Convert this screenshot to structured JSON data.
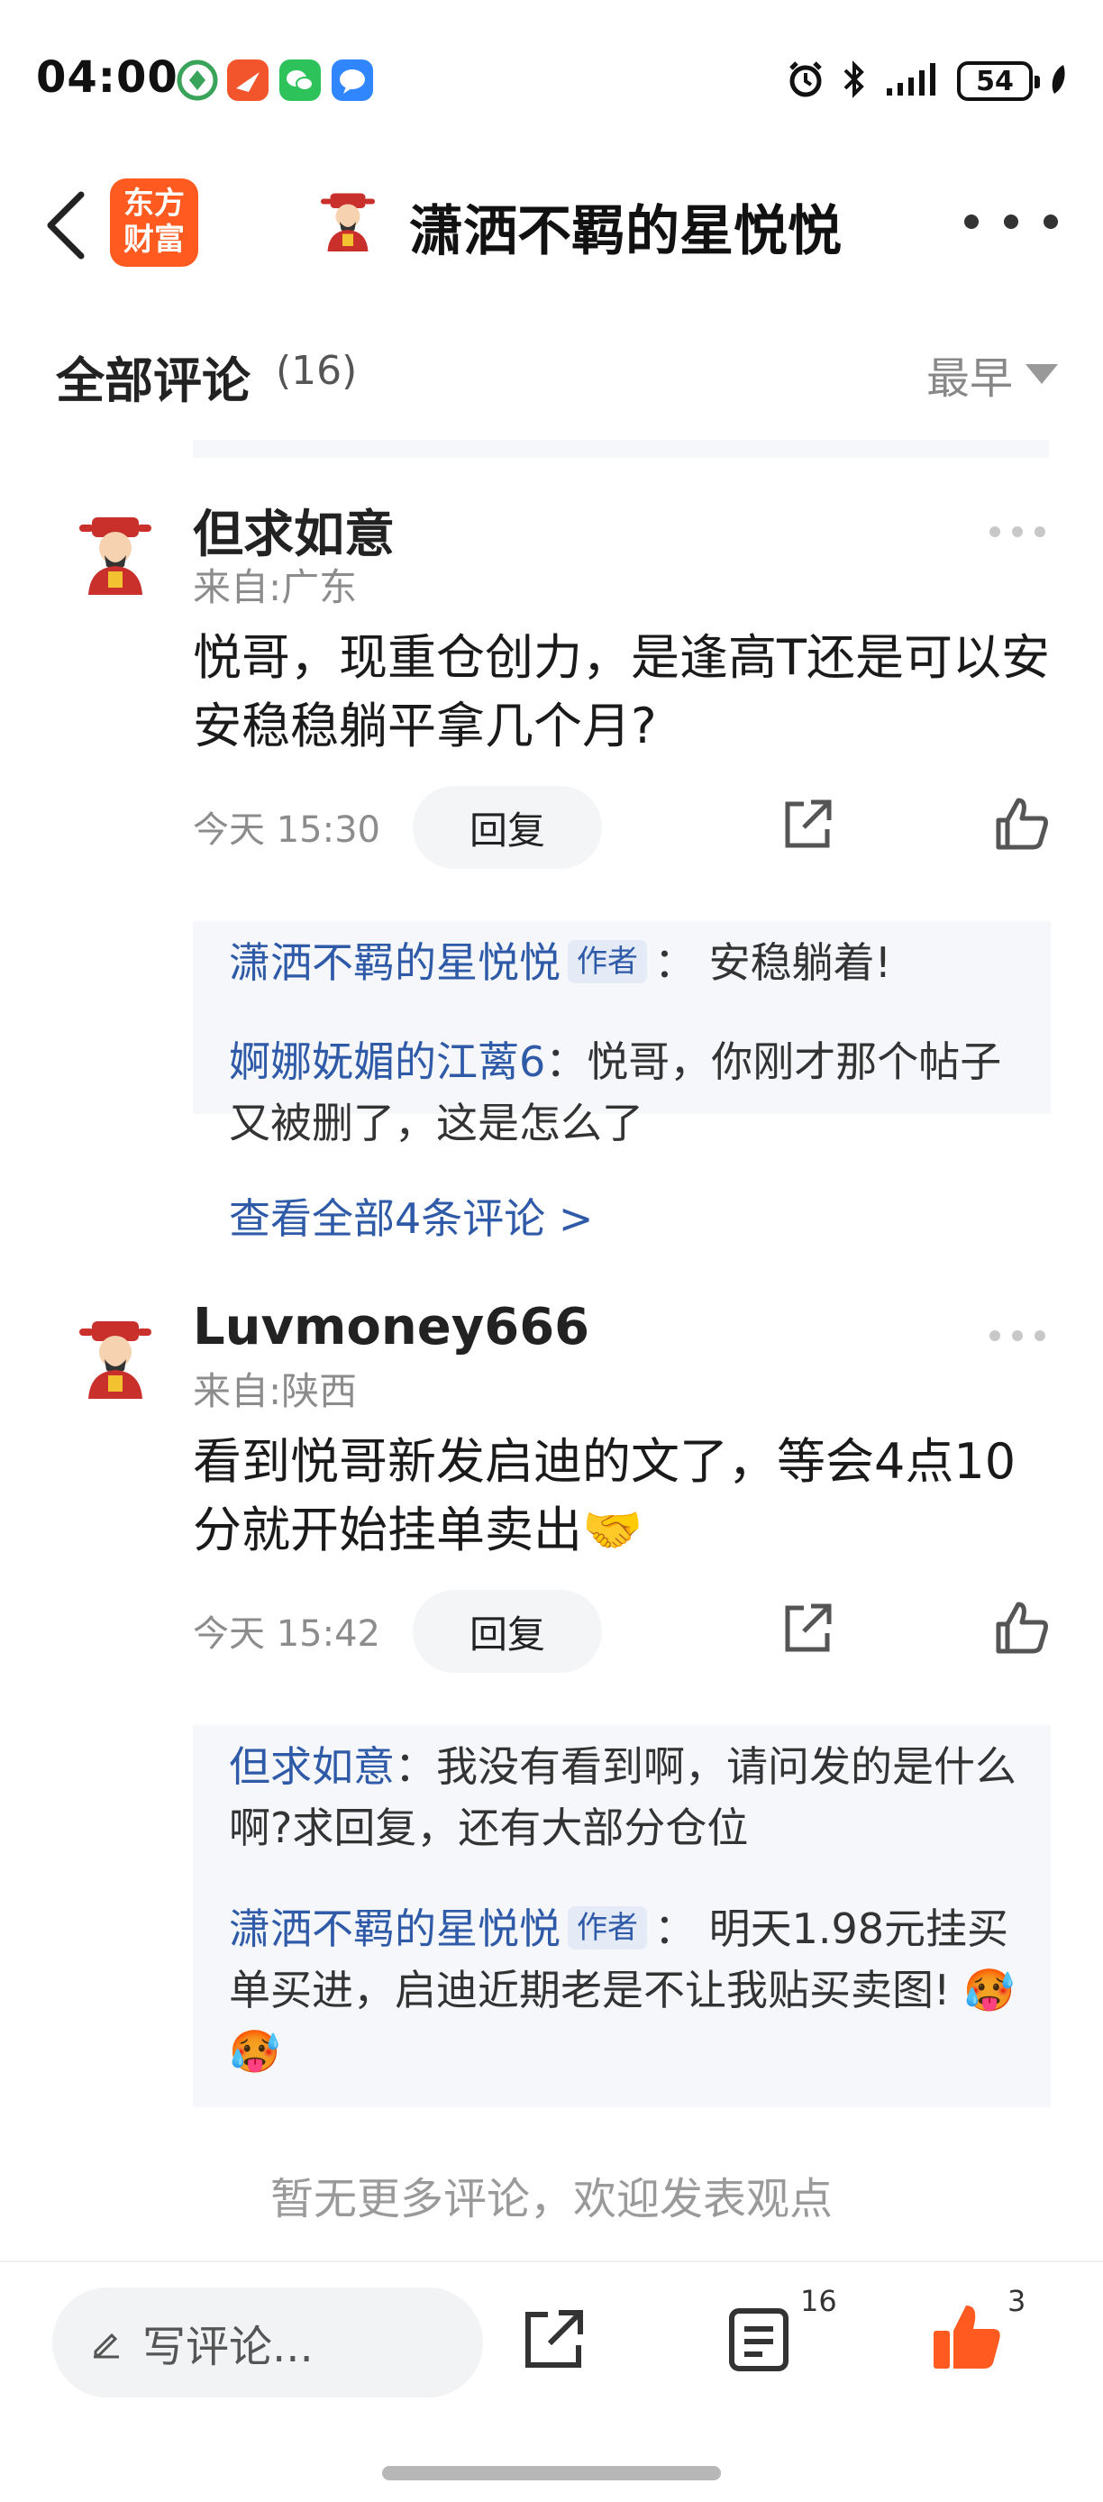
{
  "status_bar": {
    "time": "04:00",
    "battery": "54",
    "apps": [
      "network-app-icon",
      "video-app-icon",
      "wechat-icon",
      "message-app-icon"
    ]
  },
  "nav": {
    "logo_text_1": "东方",
    "logo_text_2": "财富",
    "title": "潇洒不羁的星悦悦"
  },
  "section": {
    "title": "全部评论",
    "count": "(16)",
    "sort": "最早"
  },
  "comments": [
    {
      "user": "但求如意",
      "location": "来自:广东",
      "text": "悦哥，现重仓创力，是逢高T还是可以安安稳稳躺平拿几个月?",
      "time": "今天 15:30",
      "reply_label": "回复",
      "replies": [
        {
          "name": "潇洒不羁的星悦悦",
          "tag": "作者",
          "text": "： 安稳躺着!"
        },
        {
          "name": "婀娜妩媚的江蓠6",
          "tag": "",
          "text": "：悦哥，你刚才那个帖子又被删了，这是怎么了"
        }
      ],
      "view_all": "查看全部4条评论 >"
    },
    {
      "user": "Luvmoney666",
      "location": "来自:陕西",
      "text": "看到悦哥新发启迪的文了，等会4点10分就开始挂单卖出🤝",
      "time": "今天 15:42",
      "reply_label": "回复",
      "replies": [
        {
          "name": "但求如意",
          "tag": "",
          "text": "：我没有看到啊，请问发的是什么啊?求回复，还有大部分仓位"
        },
        {
          "name": "潇洒不羁的星悦悦",
          "tag": "作者",
          "text": "： 明天1.98元挂买单买进，启迪近期老是不让我贴买卖图!  🥵🥵"
        }
      ]
    }
  ],
  "no_more_text": "暂无更多评论，欢迎发表观点",
  "bottom_bar": {
    "write_placeholder": "写评论...",
    "comment_count": "16",
    "like_count": "3"
  },
  "colors": {
    "brand": "#ff5a1f",
    "link": "#2f5aa8",
    "like_active": "#ff5a1f"
  }
}
